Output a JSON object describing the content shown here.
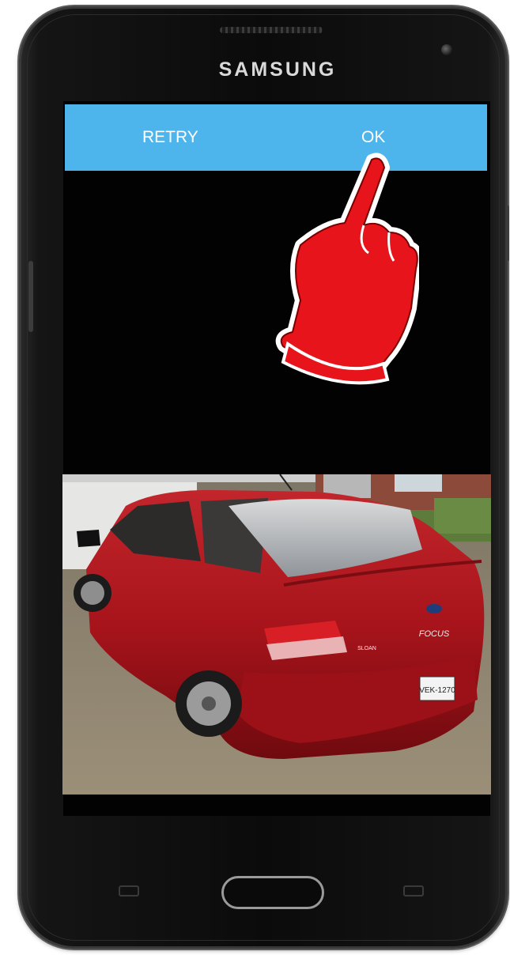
{
  "device": {
    "brand": "SAMSUNG"
  },
  "dialog": {
    "retry_label": "RETRY",
    "ok_label": "OK",
    "accent_color": "#4db5ec"
  },
  "photo": {
    "plate_text": "VEK-1270",
    "badge_text": "FOCUS",
    "dealer_badge": "SLOAN"
  },
  "pointer": {
    "icon": "pointing-hand-icon",
    "fill_color": "#e8141b"
  }
}
